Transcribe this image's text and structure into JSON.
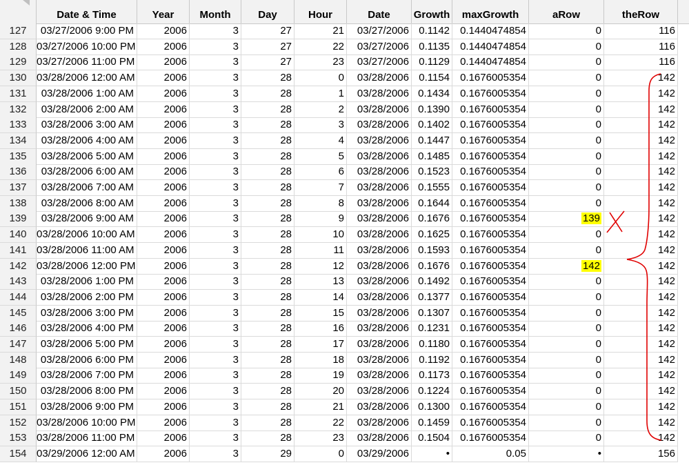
{
  "columns": [
    "Date & Time",
    "Year",
    "Month",
    "Day",
    "Hour",
    "Date",
    "Growth",
    "maxGrowth",
    "aRow",
    "theRow"
  ],
  "rows": [
    {
      "rownum": "127",
      "datetime": "03/27/2006 9:00 PM",
      "year": "2006",
      "month": "3",
      "day": "27",
      "hour": "21",
      "date": "03/27/2006",
      "growth": "0.1142",
      "maxgrowth": "0.1440474854",
      "arow": "0",
      "therow": "116"
    },
    {
      "rownum": "128",
      "datetime": "03/27/2006 10:00 PM",
      "year": "2006",
      "month": "3",
      "day": "27",
      "hour": "22",
      "date": "03/27/2006",
      "growth": "0.1135",
      "maxgrowth": "0.1440474854",
      "arow": "0",
      "therow": "116"
    },
    {
      "rownum": "129",
      "datetime": "03/27/2006 11:00 PM",
      "year": "2006",
      "month": "3",
      "day": "27",
      "hour": "23",
      "date": "03/27/2006",
      "growth": "0.1129",
      "maxgrowth": "0.1440474854",
      "arow": "0",
      "therow": "116"
    },
    {
      "rownum": "130",
      "datetime": "03/28/2006 12:00 AM",
      "year": "2006",
      "month": "3",
      "day": "28",
      "hour": "0",
      "date": "03/28/2006",
      "growth": "0.1154",
      "maxgrowth": "0.1676005354",
      "arow": "0",
      "therow": "142"
    },
    {
      "rownum": "131",
      "datetime": "03/28/2006 1:00 AM",
      "year": "2006",
      "month": "3",
      "day": "28",
      "hour": "1",
      "date": "03/28/2006",
      "growth": "0.1434",
      "maxgrowth": "0.1676005354",
      "arow": "0",
      "therow": "142"
    },
    {
      "rownum": "132",
      "datetime": "03/28/2006 2:00 AM",
      "year": "2006",
      "month": "3",
      "day": "28",
      "hour": "2",
      "date": "03/28/2006",
      "growth": "0.1390",
      "maxgrowth": "0.1676005354",
      "arow": "0",
      "therow": "142"
    },
    {
      "rownum": "133",
      "datetime": "03/28/2006 3:00 AM",
      "year": "2006",
      "month": "3",
      "day": "28",
      "hour": "3",
      "date": "03/28/2006",
      "growth": "0.1402",
      "maxgrowth": "0.1676005354",
      "arow": "0",
      "therow": "142"
    },
    {
      "rownum": "134",
      "datetime": "03/28/2006 4:00 AM",
      "year": "2006",
      "month": "3",
      "day": "28",
      "hour": "4",
      "date": "03/28/2006",
      "growth": "0.1447",
      "maxgrowth": "0.1676005354",
      "arow": "0",
      "therow": "142"
    },
    {
      "rownum": "135",
      "datetime": "03/28/2006 5:00 AM",
      "year": "2006",
      "month": "3",
      "day": "28",
      "hour": "5",
      "date": "03/28/2006",
      "growth": "0.1485",
      "maxgrowth": "0.1676005354",
      "arow": "0",
      "therow": "142"
    },
    {
      "rownum": "136",
      "datetime": "03/28/2006 6:00 AM",
      "year": "2006",
      "month": "3",
      "day": "28",
      "hour": "6",
      "date": "03/28/2006",
      "growth": "0.1523",
      "maxgrowth": "0.1676005354",
      "arow": "0",
      "therow": "142"
    },
    {
      "rownum": "137",
      "datetime": "03/28/2006 7:00 AM",
      "year": "2006",
      "month": "3",
      "day": "28",
      "hour": "7",
      "date": "03/28/2006",
      "growth": "0.1555",
      "maxgrowth": "0.1676005354",
      "arow": "0",
      "therow": "142"
    },
    {
      "rownum": "138",
      "datetime": "03/28/2006 8:00 AM",
      "year": "2006",
      "month": "3",
      "day": "28",
      "hour": "8",
      "date": "03/28/2006",
      "growth": "0.1644",
      "maxgrowth": "0.1676005354",
      "arow": "0",
      "therow": "142"
    },
    {
      "rownum": "139",
      "datetime": "03/28/2006 9:00 AM",
      "year": "2006",
      "month": "3",
      "day": "28",
      "hour": "9",
      "date": "03/28/2006",
      "growth": "0.1676",
      "maxgrowth": "0.1676005354",
      "arow": "139",
      "therow": "142",
      "highlight": true
    },
    {
      "rownum": "140",
      "datetime": "03/28/2006 10:00 AM",
      "year": "2006",
      "month": "3",
      "day": "28",
      "hour": "10",
      "date": "03/28/2006",
      "growth": "0.1625",
      "maxgrowth": "0.1676005354",
      "arow": "0",
      "therow": "142"
    },
    {
      "rownum": "141",
      "datetime": "03/28/2006 11:00 AM",
      "year": "2006",
      "month": "3",
      "day": "28",
      "hour": "11",
      "date": "03/28/2006",
      "growth": "0.1593",
      "maxgrowth": "0.1676005354",
      "arow": "0",
      "therow": "142"
    },
    {
      "rownum": "142",
      "datetime": "03/28/2006 12:00 PM",
      "year": "2006",
      "month": "3",
      "day": "28",
      "hour": "12",
      "date": "03/28/2006",
      "growth": "0.1676",
      "maxgrowth": "0.1676005354",
      "arow": "142",
      "therow": "142",
      "highlight": true
    },
    {
      "rownum": "143",
      "datetime": "03/28/2006 1:00 PM",
      "year": "2006",
      "month": "3",
      "day": "28",
      "hour": "13",
      "date": "03/28/2006",
      "growth": "0.1492",
      "maxgrowth": "0.1676005354",
      "arow": "0",
      "therow": "142"
    },
    {
      "rownum": "144",
      "datetime": "03/28/2006 2:00 PM",
      "year": "2006",
      "month": "3",
      "day": "28",
      "hour": "14",
      "date": "03/28/2006",
      "growth": "0.1377",
      "maxgrowth": "0.1676005354",
      "arow": "0",
      "therow": "142"
    },
    {
      "rownum": "145",
      "datetime": "03/28/2006 3:00 PM",
      "year": "2006",
      "month": "3",
      "day": "28",
      "hour": "15",
      "date": "03/28/2006",
      "growth": "0.1307",
      "maxgrowth": "0.1676005354",
      "arow": "0",
      "therow": "142"
    },
    {
      "rownum": "146",
      "datetime": "03/28/2006 4:00 PM",
      "year": "2006",
      "month": "3",
      "day": "28",
      "hour": "16",
      "date": "03/28/2006",
      "growth": "0.1231",
      "maxgrowth": "0.1676005354",
      "arow": "0",
      "therow": "142"
    },
    {
      "rownum": "147",
      "datetime": "03/28/2006 5:00 PM",
      "year": "2006",
      "month": "3",
      "day": "28",
      "hour": "17",
      "date": "03/28/2006",
      "growth": "0.1180",
      "maxgrowth": "0.1676005354",
      "arow": "0",
      "therow": "142"
    },
    {
      "rownum": "148",
      "datetime": "03/28/2006 6:00 PM",
      "year": "2006",
      "month": "3",
      "day": "28",
      "hour": "18",
      "date": "03/28/2006",
      "growth": "0.1192",
      "maxgrowth": "0.1676005354",
      "arow": "0",
      "therow": "142"
    },
    {
      "rownum": "149",
      "datetime": "03/28/2006 7:00 PM",
      "year": "2006",
      "month": "3",
      "day": "28",
      "hour": "19",
      "date": "03/28/2006",
      "growth": "0.1173",
      "maxgrowth": "0.1676005354",
      "arow": "0",
      "therow": "142"
    },
    {
      "rownum": "150",
      "datetime": "03/28/2006 8:00 PM",
      "year": "2006",
      "month": "3",
      "day": "28",
      "hour": "20",
      "date": "03/28/2006",
      "growth": "0.1224",
      "maxgrowth": "0.1676005354",
      "arow": "0",
      "therow": "142"
    },
    {
      "rownum": "151",
      "datetime": "03/28/2006 9:00 PM",
      "year": "2006",
      "month": "3",
      "day": "28",
      "hour": "21",
      "date": "03/28/2006",
      "growth": "0.1300",
      "maxgrowth": "0.1676005354",
      "arow": "0",
      "therow": "142"
    },
    {
      "rownum": "152",
      "datetime": "03/28/2006 10:00 PM",
      "year": "2006",
      "month": "3",
      "day": "28",
      "hour": "22",
      "date": "03/28/2006",
      "growth": "0.1459",
      "maxgrowth": "0.1676005354",
      "arow": "0",
      "therow": "142"
    },
    {
      "rownum": "153",
      "datetime": "03/28/2006 11:00 PM",
      "year": "2006",
      "month": "3",
      "day": "28",
      "hour": "23",
      "date": "03/28/2006",
      "growth": "0.1504",
      "maxgrowth": "0.1676005354",
      "arow": "0",
      "therow": "142"
    },
    {
      "rownum": "154",
      "datetime": "03/29/2006 12:00 AM",
      "year": "2006",
      "month": "3",
      "day": "29",
      "hour": "0",
      "date": "03/29/2006",
      "growth": "•",
      "maxgrowth": "0.05",
      "arow": "•",
      "therow": "156"
    }
  ],
  "colors": {
    "header_bg": "#f2f2f2",
    "gridline": "#dadada",
    "highlight": "#ffff00",
    "annotation": "#e00000"
  }
}
